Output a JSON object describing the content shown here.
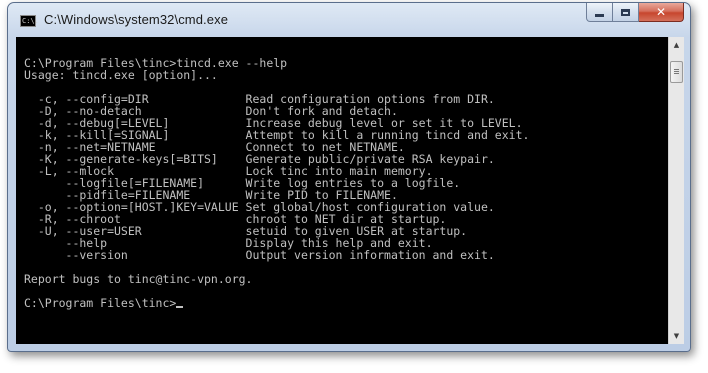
{
  "window": {
    "title": "C:\\Windows\\system32\\cmd.exe",
    "icon": "cmd-icon",
    "icon_text": "C:\\."
  },
  "caption": {
    "minimize": "minimize-icon",
    "maximize": "maximize-icon",
    "close": "close-icon",
    "close_glyph": "✕"
  },
  "console": {
    "lines": [
      "C:\\Program Files\\tinc>tincd.exe --help",
      "Usage: tincd.exe [option]...",
      "",
      "  -c, --config=DIR              Read configuration options from DIR.",
      "  -D, --no-detach               Don't fork and detach.",
      "  -d, --debug[=LEVEL]           Increase debug level or set it to LEVEL.",
      "  -k, --kill[=SIGNAL]           Attempt to kill a running tincd and exit.",
      "  -n, --net=NETNAME             Connect to net NETNAME.",
      "  -K, --generate-keys[=BITS]    Generate public/private RSA keypair.",
      "  -L, --mlock                   Lock tinc into main memory.",
      "      --logfile[=FILENAME]      Write log entries to a logfile.",
      "      --pidfile=FILENAME        Write PID to FILENAME.",
      "  -o, --option=[HOST.]KEY=VALUE Set global/host configuration value.",
      "  -R, --chroot                  chroot to NET dir at startup.",
      "  -U, --user=USER               setuid to given USER at startup.",
      "      --help                    Display this help and exit.",
      "      --version                 Output version information and exit.",
      "",
      "Report bugs to tinc@tinc-vpn.org.",
      ""
    ],
    "prompt": "C:\\Program Files\\tinc>"
  },
  "scrollbar": {
    "up_arrow": "▲",
    "down_arrow": "▼",
    "position": 0.03
  }
}
